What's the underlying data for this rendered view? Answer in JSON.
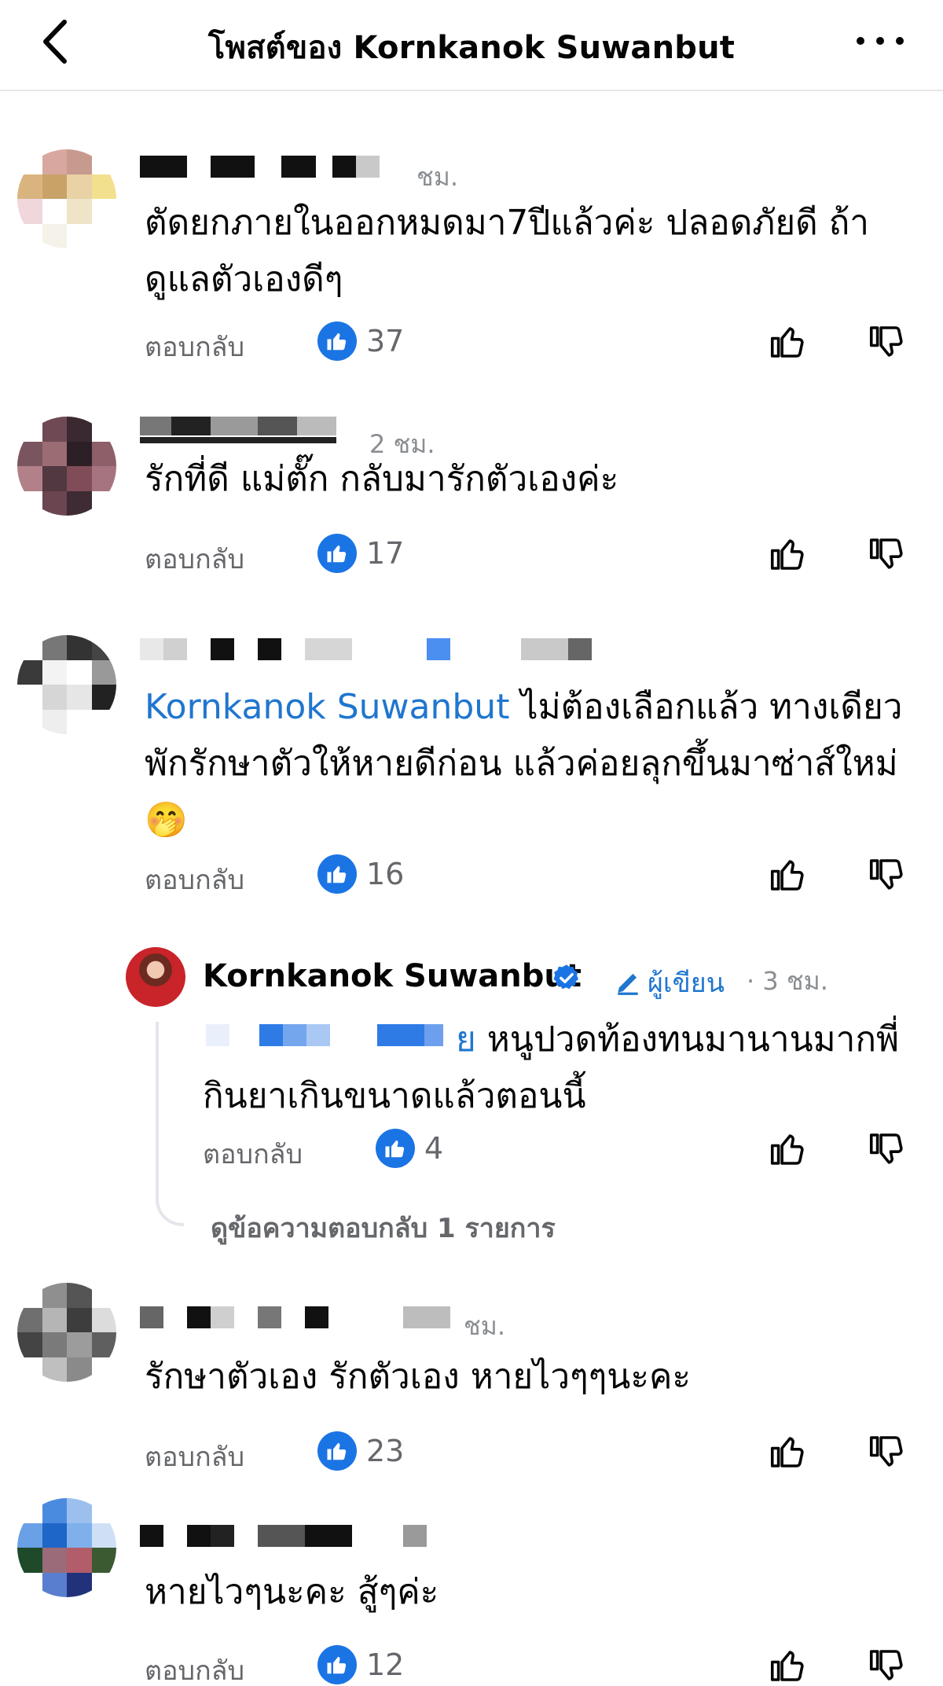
{
  "header": {
    "title": "โพสต์ของ Kornkanok Suwanbut"
  },
  "comments": [
    {
      "time": "ชม.",
      "text": "ตัดยกภายในออกหมดมา7ปีแล้วค่ะ ปลอดภัยดี ถ้าดูแลตัวเองดีๆ",
      "reply_label": "ตอบกลับ",
      "likes": "37"
    },
    {
      "time": "2 ชม.",
      "text": "รักที่ดี แม่ตั๊ก กลับมารักตัวเองค่ะ",
      "reply_label": "ตอบกลับ",
      "likes": "17"
    },
    {
      "mention": "Kornkanok Suwanbut",
      "text": "ไม่ต้องเลือกแล้ว ทางเดียวพักรักษาตัวให้หายดีก่อน แล้วค่อยลุกขึ้นมาซ่าส์ใหม่🤭",
      "reply_label": "ตอบกลับ",
      "likes": "16"
    },
    {
      "time": "ชม.",
      "text": "รักษาตัวเอง รักตัวเอง หายไวๆๆนะคะ",
      "reply_label": "ตอบกลับ",
      "likes": "23"
    },
    {
      "text": "หายไวๆนะคะ สู้ๆค่ะ",
      "reply_label": "ตอบกลับ",
      "likes": "12"
    }
  ],
  "reply": {
    "author": "Kornkanok Suwanbut",
    "author_badge": "ผู้เขียน",
    "time": "· 3 ชม.",
    "mention_tail": "ย",
    "text": "หนูปวดท้องทนมานานมากพี่ กินยาเกินขนาดแล้วตอนนี้",
    "reply_label": "ตอบกลับ",
    "likes": "4",
    "view_replies": "ดูข้อความตอบกลับ 1 รายการ"
  },
  "colors": {
    "like_blue": "#1b74e4",
    "mention_blue": "#1f76cf",
    "meta_gray": "#65676b"
  },
  "icons": [
    "back-chevron-icon",
    "more-dots-icon",
    "like-badge-icon",
    "thumbs-up-icon",
    "thumbs-down-icon",
    "verified-badge-icon",
    "pencil-icon"
  ]
}
